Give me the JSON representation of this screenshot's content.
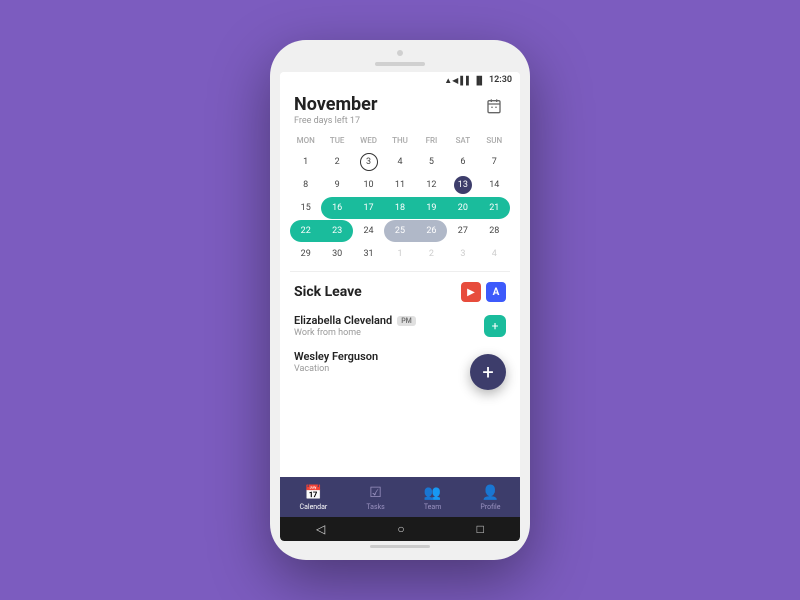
{
  "phone": {
    "status": {
      "time": "12:30",
      "icons": [
        "▲◀",
        "▌▌",
        "🔋"
      ]
    },
    "calendar": {
      "month": "November",
      "subtitle": "Free days left 17",
      "days_header": [
        "MON",
        "TUE",
        "WED",
        "THU",
        "FRI",
        "SAT",
        "SUN"
      ],
      "weeks": [
        [
          {
            "n": "1",
            "type": "normal"
          },
          {
            "n": "2",
            "type": "normal"
          },
          {
            "n": "3",
            "type": "today"
          },
          {
            "n": "4",
            "type": "normal"
          },
          {
            "n": "5",
            "type": "normal"
          },
          {
            "n": "6",
            "type": "normal"
          },
          {
            "n": "7",
            "type": "normal"
          }
        ],
        [
          {
            "n": "8",
            "type": "normal"
          },
          {
            "n": "9",
            "type": "normal"
          },
          {
            "n": "10",
            "type": "normal"
          },
          {
            "n": "11",
            "type": "normal"
          },
          {
            "n": "12",
            "type": "normal"
          },
          {
            "n": "13",
            "type": "selected"
          },
          {
            "n": "14",
            "type": "normal"
          }
        ],
        [
          {
            "n": "15",
            "type": "normal"
          },
          {
            "n": "16",
            "type": "teal-start"
          },
          {
            "n": "17",
            "type": "teal"
          },
          {
            "n": "18",
            "type": "teal"
          },
          {
            "n": "19",
            "type": "teal"
          },
          {
            "n": "20",
            "type": "teal"
          },
          {
            "n": "21",
            "type": "teal-end"
          }
        ],
        [
          {
            "n": "22",
            "type": "teal-start"
          },
          {
            "n": "23",
            "type": "teal-end"
          },
          {
            "n": "24",
            "type": "normal"
          },
          {
            "n": "25",
            "type": "gray-start"
          },
          {
            "n": "26",
            "type": "gray-end"
          },
          {
            "n": "27",
            "type": "normal"
          },
          {
            "n": "28",
            "type": "normal"
          }
        ],
        [
          {
            "n": "29",
            "type": "normal"
          },
          {
            "n": "30",
            "type": "normal"
          },
          {
            "n": "31",
            "type": "normal"
          },
          {
            "n": "1",
            "type": "empty"
          },
          {
            "n": "2",
            "type": "empty"
          },
          {
            "n": "3",
            "type": "empty"
          },
          {
            "n": "4",
            "type": "empty"
          }
        ]
      ]
    },
    "sick_leave": {
      "title": "Sick Leave",
      "icons": {
        "red_label": "▶",
        "blue_label": "A"
      }
    },
    "list_items": [
      {
        "name": "Elizabella Cleveland",
        "badge": "PM",
        "sub": "Work from home",
        "has_action": true,
        "action_icon": "+"
      },
      {
        "name": "Wesley Ferguson",
        "badge": "",
        "sub": "Vacation",
        "has_action": false
      }
    ],
    "fab_label": "+",
    "bottom_nav": {
      "items": [
        {
          "icon": "📅",
          "label": "Calendar",
          "active": true
        },
        {
          "icon": "✓",
          "label": "Tasks",
          "active": false
        },
        {
          "icon": "👥",
          "label": "Team",
          "active": false
        },
        {
          "icon": "👤",
          "label": "Profile",
          "active": false
        }
      ]
    },
    "android_nav": {
      "back": "◁",
      "home": "○",
      "recent": "□"
    }
  }
}
